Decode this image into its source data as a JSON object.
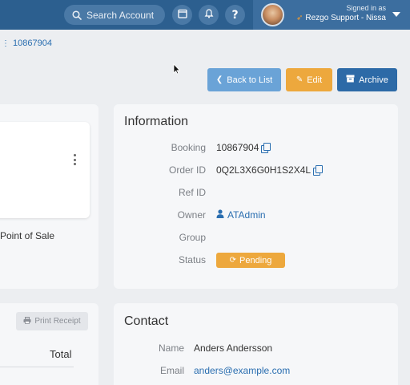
{
  "header": {
    "search_placeholder": "Search Account",
    "help_label": "?",
    "signed_in_label": "Signed in as",
    "signed_in_user": "Rezgo Support - Nissa"
  },
  "breadcrumb": {
    "text": "10867904"
  },
  "actions": {
    "back_label": "Back to List",
    "edit_label": "Edit",
    "archive_label": "Archive"
  },
  "left_panel": {
    "pos_label": "Point of Sale",
    "print_label": "Print Receipt",
    "total_label": "Total"
  },
  "information": {
    "title": "Information",
    "rows": [
      {
        "label": "Booking",
        "value": "10867904"
      },
      {
        "label": "Order ID",
        "value": "0Q2L3X6G0H1S2X4L"
      },
      {
        "label": "Ref ID",
        "value": ""
      },
      {
        "label": "Owner",
        "value": "ATAdmin"
      },
      {
        "label": "Group",
        "value": ""
      },
      {
        "label": "Status",
        "value": "Pending"
      }
    ]
  },
  "contact": {
    "title": "Contact",
    "rows": [
      {
        "label": "Name",
        "value": "Anders Andersson"
      },
      {
        "label": "Email",
        "value": "anders@example.com"
      }
    ]
  },
  "colors": {
    "topbar": "#2c5f8f",
    "accent_blue": "#2a6eb0",
    "edit_orange": "#eda83d",
    "archive_blue": "#2d6aa7",
    "back_blue": "#6aa3d7"
  },
  "icons": {
    "search": "search-icon",
    "calendar": "calendar-icon",
    "bell": "bell-icon",
    "help": "help-icon",
    "rocket": "rocket-icon",
    "caret": "caret-down-icon",
    "back": "chevron-left-icon",
    "edit": "pencil-icon",
    "archive": "archive-icon",
    "copy": "copy-icon",
    "user": "user-icon",
    "sync": "sync-icon",
    "printer": "printer-icon",
    "kebab": "kebab-icon"
  }
}
